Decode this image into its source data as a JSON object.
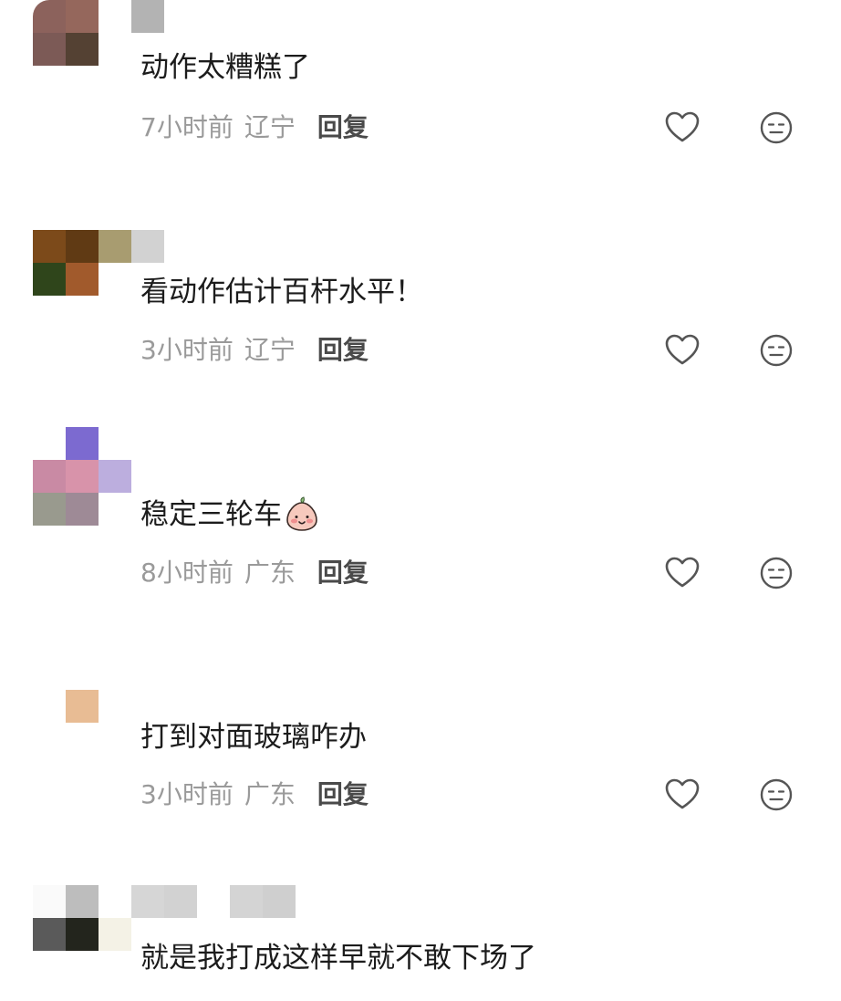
{
  "comments": [
    {
      "text": "动作太糟糕了",
      "time": "7小时前",
      "location": "辽宁",
      "reply": "回复",
      "avatar_cells": [
        "#8c625c",
        "#95675c",
        "#ffffff",
        "#7c5a56",
        "#544133",
        "#ffffff",
        "#ffffff",
        "#ffffff",
        "#ffffff"
      ],
      "name_cells": [
        "#b3b3b3"
      ]
    },
    {
      "text": "看动作估计百杆水平！",
      "time": "3小时前",
      "location": "辽宁",
      "reply": "回复",
      "avatar_cells": [
        "#7c4a1a",
        "#603a14",
        "#a89c70",
        "#2f451b",
        "#a15a2c",
        "#ffffff",
        "#ffffff",
        "#ffffff",
        "#ffffff"
      ],
      "name_cells": [
        "#d2d2d2"
      ]
    },
    {
      "text": "稳定三轮车",
      "emoji": "smiling-peach-emoji",
      "time": "8小时前",
      "location": "广东",
      "reply": "回复",
      "avatar_cells": [
        "#ffffff",
        "#7c6ad0",
        "#ffffff",
        "#c98aa4",
        "#d893aa",
        "#bcaede",
        "#999a8e",
        "#9e8a96",
        "#ffffff"
      ],
      "name_cells": []
    },
    {
      "text": "打到对面玻璃咋办",
      "time": "3小时前",
      "location": "广东",
      "reply": "回复",
      "avatar_cells": [
        "#ffffff",
        "#ffffff",
        "#ffffff",
        "#ffffff",
        "#e8bc94",
        "#ffffff",
        "#ffffff",
        "#ffffff",
        "#ffffff"
      ],
      "name_cells": []
    },
    {
      "text": "就是我打成这样早就不敢下场了",
      "avatar_cells": [
        "#fafafa",
        "#bdbdbd",
        "#ffffff",
        "#5a5a5a",
        "#23251d",
        "#f4f2e6",
        "#ffffff",
        "#ffffff",
        "#ffffff"
      ],
      "name_cells": [
        "#d6d6d6",
        "#d2d2d2",
        "#ffffff",
        "#d4d4d4",
        "#cfcfcf"
      ]
    }
  ],
  "icons": {
    "like": "heart-icon",
    "dislike": "neutral-face-icon"
  },
  "colors": {
    "text": "#1c1c1c",
    "meta": "#9a9a9a",
    "reply": "#4a4a4a",
    "icon": "#555555"
  }
}
